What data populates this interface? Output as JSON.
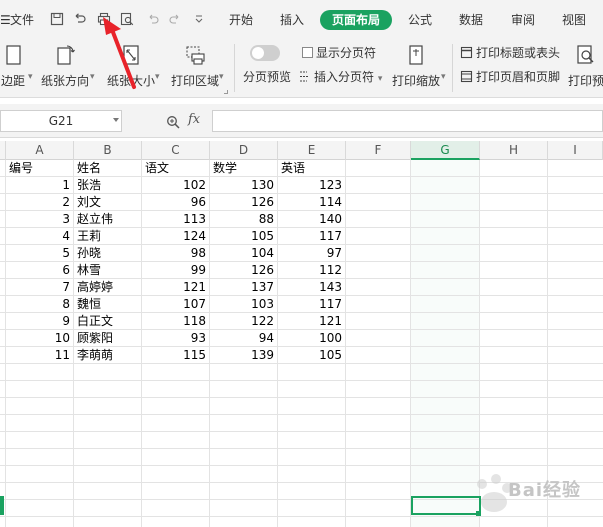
{
  "menubar": {
    "file_label": "文件",
    "tabs": [
      {
        "label": "开始"
      },
      {
        "label": "插入"
      },
      {
        "label": "页面布局",
        "active": true
      },
      {
        "label": "公式"
      },
      {
        "label": "数据"
      },
      {
        "label": "审阅"
      },
      {
        "label": "视图"
      }
    ]
  },
  "ribbon": {
    "margins": "边距",
    "orientation": "纸张方向",
    "size": "纸张大小",
    "print_area": "打印区域",
    "page_break_preview": "分页预览",
    "show_page_breaks": "显示分页符",
    "insert_page_break": "插入分页符",
    "print_scale": "打印缩放",
    "print_titles": "打印标题或表头",
    "header_footer": "打印页眉和页脚",
    "print_preview": "打印预"
  },
  "formulabar": {
    "cell_ref": "G21",
    "fx": "fx",
    "value": ""
  },
  "sheet": {
    "columns": [
      "A",
      "B",
      "C",
      "D",
      "E",
      "F",
      "G",
      "H",
      "I"
    ],
    "selected_column": "G",
    "header_row": [
      "编号",
      "姓名",
      "语文",
      "数学",
      "英语"
    ],
    "rows": [
      {
        "id": "1",
        "name": "张浩",
        "chinese": "102",
        "math": "130",
        "english": "123"
      },
      {
        "id": "2",
        "name": "刘文",
        "chinese": "96",
        "math": "126",
        "english": "114"
      },
      {
        "id": "3",
        "name": "赵立伟",
        "chinese": "113",
        "math": "88",
        "english": "140"
      },
      {
        "id": "4",
        "name": "王莉",
        "chinese": "124",
        "math": "105",
        "english": "117"
      },
      {
        "id": "5",
        "name": "孙晓",
        "chinese": "98",
        "math": "104",
        "english": "97"
      },
      {
        "id": "6",
        "name": "林雪",
        "chinese": "99",
        "math": "126",
        "english": "112"
      },
      {
        "id": "7",
        "name": "高婷婷",
        "chinese": "121",
        "math": "137",
        "english": "143"
      },
      {
        "id": "8",
        "name": "魏恒",
        "chinese": "107",
        "math": "103",
        "english": "117"
      },
      {
        "id": "9",
        "name": "白正文",
        "chinese": "118",
        "math": "122",
        "english": "121"
      },
      {
        "id": "10",
        "name": "顾紫阳",
        "chinese": "93",
        "math": "94",
        "english": "100"
      },
      {
        "id": "11",
        "name": "李萌萌",
        "chinese": "115",
        "math": "139",
        "english": "105"
      }
    ]
  },
  "watermark": {
    "text": "Bai经验"
  },
  "colors": {
    "accent": "#1aa260",
    "annotation_arrow": "#e8232a"
  }
}
